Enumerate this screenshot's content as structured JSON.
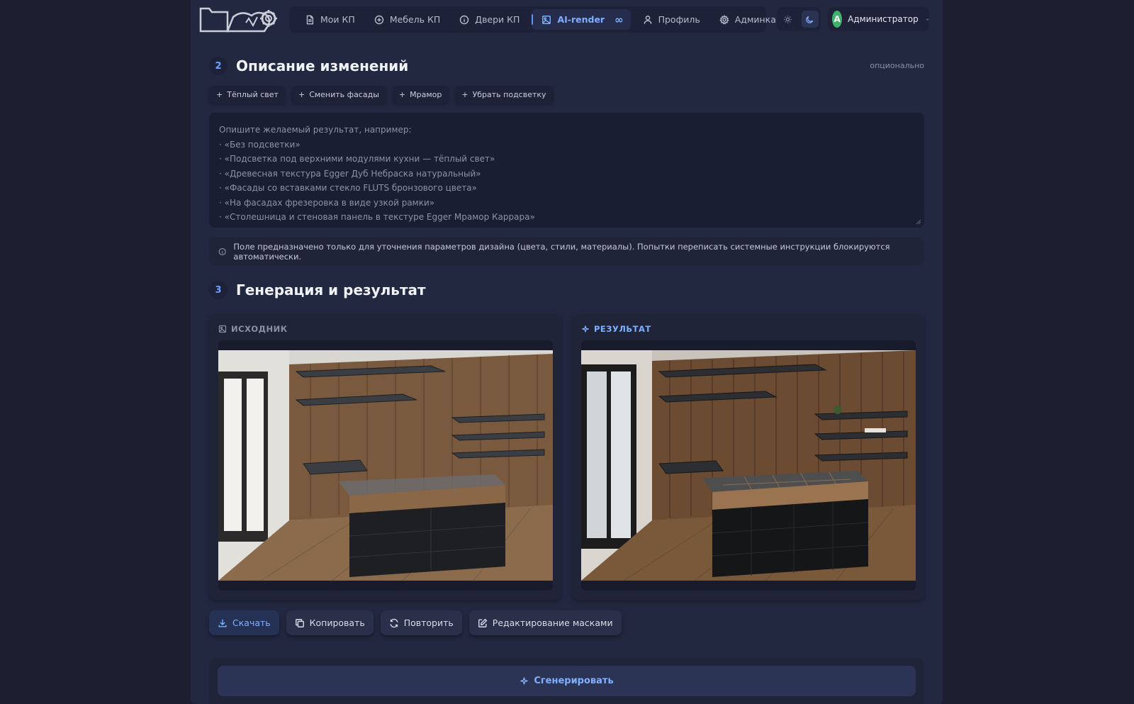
{
  "nav": {
    "items": [
      {
        "label": "Мои КП",
        "icon": "document-icon"
      },
      {
        "label": "Мебель КП",
        "icon": "plus-circle-icon"
      },
      {
        "label": "Двери КП",
        "icon": "info-circle-icon"
      },
      {
        "label": "AI-render",
        "icon": "image-icon",
        "active": true,
        "badge": "∞"
      },
      {
        "label": "Профиль",
        "icon": "user-icon"
      },
      {
        "label": "Админка",
        "icon": "gear-icon"
      }
    ],
    "theme_active": "dark",
    "user": {
      "initial": "A",
      "name": "Администратор"
    }
  },
  "section_description": {
    "step": "2",
    "title": "Описание изменений",
    "optional_label": "опционально",
    "chips": [
      "Тёплый свет",
      "Сменить фасады",
      "Мрамор",
      "Убрать подсветку"
    ],
    "placeholder_lines": [
      "Опишите желаемый результат, например:",
      "· «Без подсветки»",
      "· «Подсветка под верхними модулями кухни — тёплый свет»",
      "· «Древесная текстура Egger Дуб Небраска натуральный»",
      "· «Фасады со вставками стекло FLUTS бронзового цвета»",
      "· «На фасадах фрезеровка в виде узкой рамки»",
      "· «Столешница и стеновая панель в текстуре Egger Мрамор Каррара»"
    ],
    "notice": "Поле предназначено только для уточнения параметров дизайна (цвета, стили, материалы). Попытки переписать системные инструкции блокируются автоматически."
  },
  "section_generation": {
    "step": "3",
    "title": "Генерация и результат",
    "source_label": "ИСХОДНИК",
    "result_label": "РЕЗУЛЬТАТ",
    "actions": [
      "Скачать",
      "Копировать",
      "Повторить",
      "Редактирование масками"
    ],
    "generate_label": "Сгенерировать"
  },
  "colors": {
    "accent": "#7fb0ff",
    "background": "#1b1f30",
    "card": "#1f2439",
    "avatar": "#3fb26b"
  }
}
